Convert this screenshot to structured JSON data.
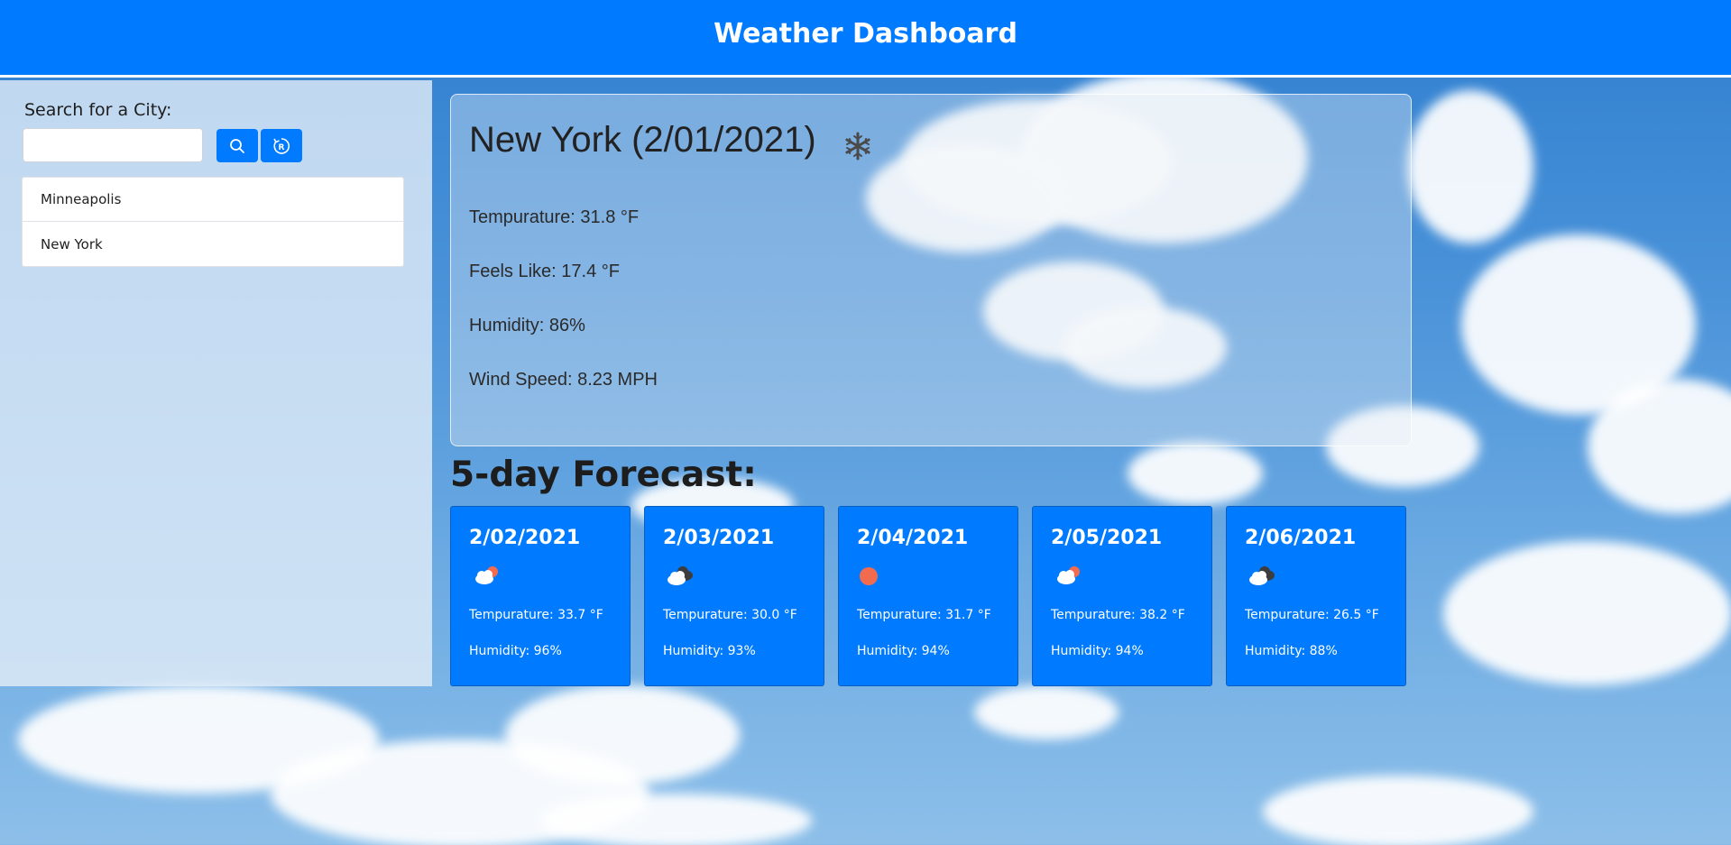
{
  "header": {
    "title": "Weather Dashboard"
  },
  "sidebar": {
    "search_label": "Search for a City:",
    "search_value": "",
    "search_button_icon": "search-icon",
    "reset_button_icon": "reset-icon",
    "cities": [
      {
        "label": "Minneapolis"
      },
      {
        "label": "New York"
      }
    ]
  },
  "current": {
    "title": "New York (2/01/2021)",
    "icon": "snowflake-icon",
    "temperature": "Tempurature: 31.8 °F",
    "feels_like": "Feels Like: 17.4 °F",
    "humidity": "Humidity: 86%",
    "wind": "Wind Speed: 8.23 MPH"
  },
  "forecast": {
    "heading": "5-day Forecast:",
    "days": [
      {
        "date": "2/02/2021",
        "icon": "cloud-sun-icon",
        "temp": "Tempurature: 33.7 °F",
        "humidity": "Humidity: 96%"
      },
      {
        "date": "2/03/2021",
        "icon": "cloud-dark-icon",
        "temp": "Tempurature: 30.0 °F",
        "humidity": "Humidity: 93%"
      },
      {
        "date": "2/04/2021",
        "icon": "sun-icon",
        "temp": "Tempurature: 31.7 °F",
        "humidity": "Humidity: 94%"
      },
      {
        "date": "2/05/2021",
        "icon": "cloud-sun-icon",
        "temp": "Tempurature: 38.2 °F",
        "humidity": "Humidity: 94%"
      },
      {
        "date": "2/06/2021",
        "icon": "cloud-dark-icon",
        "temp": "Tempurature: 26.5 °F",
        "humidity": "Humidity: 88%"
      }
    ]
  },
  "colors": {
    "primary": "#007bff",
    "white": "#ffffff"
  }
}
